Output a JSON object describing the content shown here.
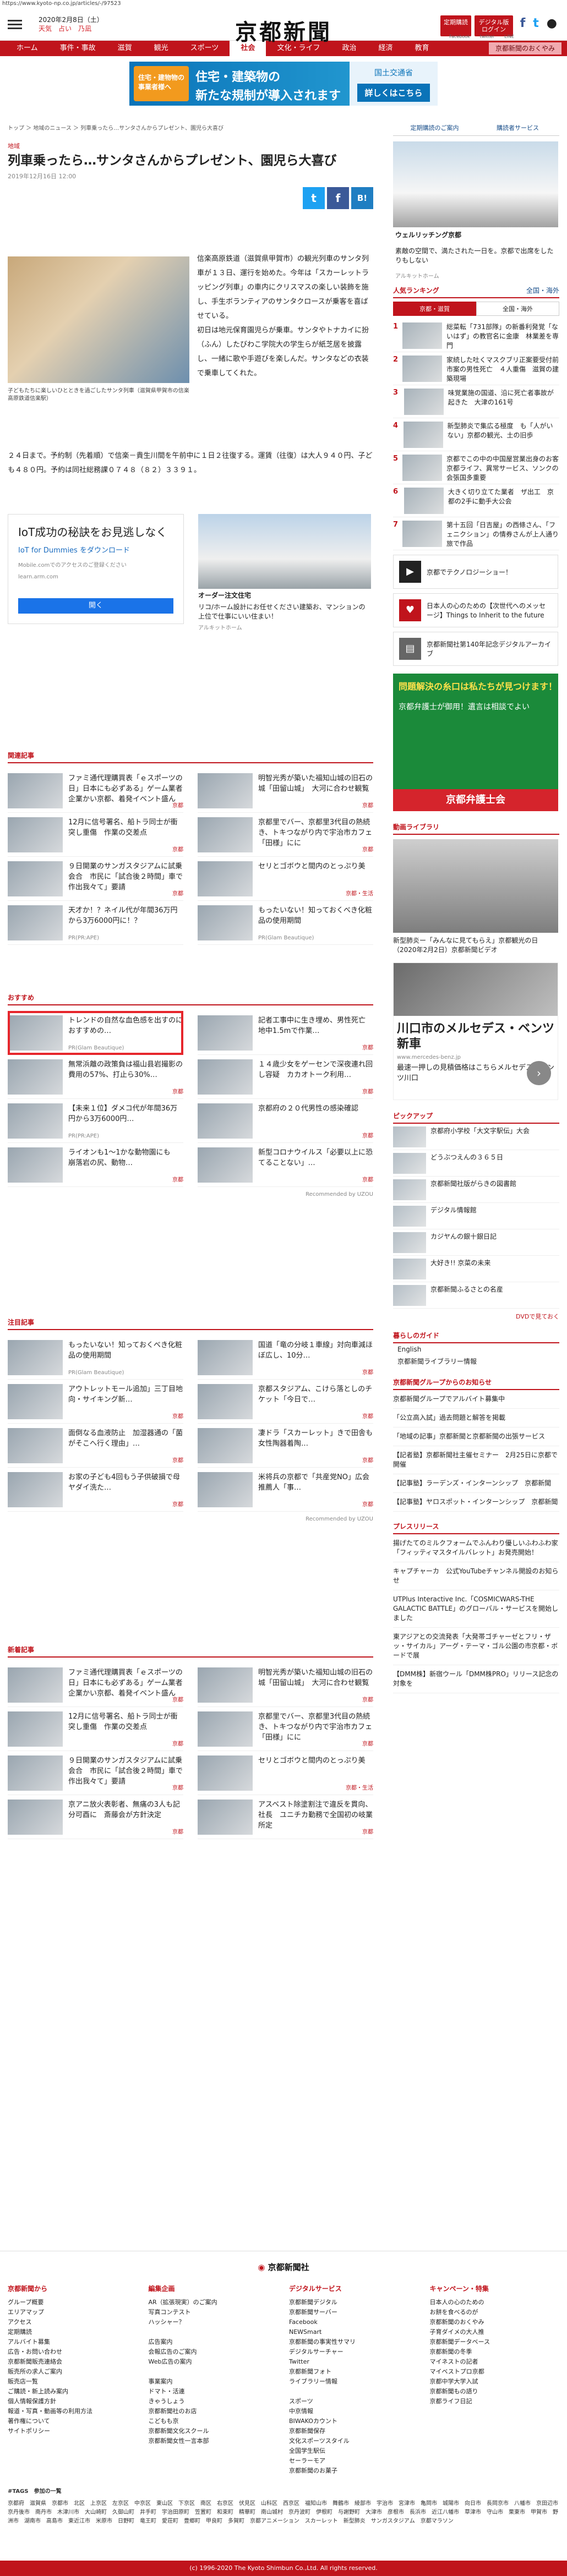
{
  "url": "https://www.kyoto-np.co.jp/articles/-/97523",
  "header": {
    "date": "2020年2月8日（土）",
    "weather": "天気",
    "fortune": "占い",
    "bus": "乃凪",
    "logo": "京都新聞",
    "btn1": "定期購読",
    "btn2": "デジタル版ログイン",
    "fb": "f",
    "tw": "t",
    "fb_label": "Facebook",
    "tw_label": "twitter",
    "line": "LINE"
  },
  "nav": [
    "ホーム",
    "事件・事故",
    "滋賀",
    "観光",
    "スポーツ",
    "社会",
    "文化・ライフ",
    "政治",
    "経済",
    "教育",
    "京都新聞のおくやみ"
  ],
  "nav_active": 5,
  "top_ad": {
    "stamp": "住宅・建物物の事業者様へ",
    "l1": "住宅・建築物の",
    "l2": "新たな規制が導入されます",
    "r1": "国土交通省",
    "btn": "詳しくはこちら"
  },
  "article": {
    "crumb": "トップ ＞ 地域のニュース ＞ 列車乗ったら…サンタさんからプレゼント、園児ら大喜び",
    "cat": "地域",
    "title": "列車乗ったら…サンタさんからプレゼント、園児ら大喜び",
    "date": "2019年12月16日 12:00",
    "share_tw": "t",
    "share_fb": "f",
    "share_b": "B!",
    "caption": "子どもたちに楽しいひとときを過ごしたサンタ列車（滋賀県甲賀市の信楽高原鉄道信楽駅）",
    "p1": "信楽高原鉄道（滋賀県甲賀市）の観光列車のサンタ列車が１３日、運行を始めた。今年は「スカーレットラッピング列車」の車内にクリスマスの楽しい装飾を施し、手生ボランティアのサンタクロースが乗客を喜ばせている。",
    "p2": "初日は地元保育園児らが乗車。サンタやトナカイに扮（ふん）したびわこ学院大の学生らが紙芝居を披露し、一緒に歌や手遊びを楽しんだ。サンタなどの衣装で乗車してくれた。",
    "p3": "２４日まで。予約制（先着順）で信楽－貴生川間を午前中に１日２往復する。運賃（往復）は大人９４０円、子ども４８０円。予約は同社総務課０７４８（８２）３３９１。"
  },
  "ad2": {
    "title": "IoT成功の秘訣をお見逃しなく",
    "sub": "IoT for Dummies をダウンロード",
    "note": "Mobile.comでのアクセスのご登録ください",
    "url": "learn.arm.com",
    "btn": "開く",
    "r_title": "オーダー注文住宅",
    "r_text": "リコ/ホーム設計にお任せください建築お、マンションの上位で仕事にいい住まい！",
    "r_src": "アルキットホーム"
  },
  "related": {
    "title": "関連記事",
    "items": [
      {
        "t": "ファミ通代理購買表「ｅスポーツの日」日本にも必ずある」ゲーム業者企業かい京都、着発イベント盛ん",
        "tag": "京都"
      },
      {
        "t": "明智光秀が築いた福知山城の旧石の城「田留山城」　大河に合わせ観覧",
        "tag": "京都"
      },
      {
        "t": "12月に信号署名、船トラ同士が衝突し重傷　作業の交差点",
        "tag": "京都"
      },
      {
        "t": "京都里でバー、京都里3代目の熱続き、トキつながり内で宇治市カフェ「田様」にに",
        "tag": "京都"
      },
      {
        "t": "９日開業のサンガスタジアムに試乗会合　市民に「試合後２時間」車で作出我々て」要請",
        "tag": "京都"
      },
      {
        "t": "セリとゴボウと間内のとっぷり美",
        "tag": "京都・生活"
      },
      {
        "t": "天才か！？ネイル代が年間36万円から3万6000円に！？",
        "tag": "PR(PR:APE)"
      },
      {
        "t": "もったいない！知っておくべき化粧品の使用期間",
        "tag": "PR(Glam Beautique)"
      }
    ]
  },
  "recommend": {
    "title": "おすすめ",
    "items": [
      {
        "t": "トレンドの自然な血色感を出すのにおすすめの…",
        "tag": "PR(Glam Beautique)"
      },
      {
        "t": "記者工事中に生き埋め、男性死亡　地中1.5mで作業…",
        "tag": "京都"
      },
      {
        "t": "無常浜離の政策負は福山县岩撮影の費用の57%、打止ら30%…",
        "tag": "京都"
      },
      {
        "t": "１４歳少女をゲーセンで深夜連れ回し容疑　カカオトーク利用…",
        "tag": "京都"
      },
      {
        "t": "【未来１位】ダメコ代が年間36万円から3万6000円…",
        "tag": "PR(PR:APE)"
      },
      {
        "t": "京都府の２０代男性の感染確認",
        "tag": "京都"
      },
      {
        "t": "ライオンも1～1かな動物園にも　崩落岩の尻、動物…",
        "tag": "京都"
      },
      {
        "t": "新型コロナウイルス「必要以上に恐てることない」…",
        "tag": "京都"
      }
    ],
    "uzou": "Recommended by UZOU"
  },
  "featured": {
    "title": "注目記事",
    "items": [
      {
        "t": "もったいない！知っておくべき化粧品の使用期間",
        "tag": "PR(Glam Beautique)"
      },
      {
        "t": "国道「竜の分岐１車線」対向車減ほぼ広し、10分…",
        "tag": "京都"
      },
      {
        "t": "アウトレットモール追加」三丁目地向・サイキング新…",
        "tag": "京都"
      },
      {
        "t": "京都スタジアム、こけら落としのチケット「今日で…",
        "tag": "京都"
      },
      {
        "t": "面倒なる血液防止　加湿器通の「菌がそこへ行く理由」…",
        "tag": "京都"
      },
      {
        "t": "凄ドラ「スカーレット」きで田舎も　女性陶器着陶…",
        "tag": "京都"
      },
      {
        "t": "お家の子ども4回もう子供破損で母ヤダイ洗た…",
        "tag": "京都"
      },
      {
        "t": "米将兵の京都で「共産党NO」広会　推薦人「事…",
        "tag": "京都"
      }
    ],
    "uzou": "Recommended by UZOU"
  },
  "new": {
    "title": "新着記事",
    "items": [
      {
        "t": "ファミ通代理購買表「ｅスポーツの日」日本にも必ずある」ゲーム業者企業かい京都、着発イベント盛ん",
        "tag": "京都"
      },
      {
        "t": "明智光秀が築いた福知山城の旧石の城「田留山城」　大河に合わせ観覧",
        "tag": "京都"
      },
      {
        "t": "12月に信号署名、船トラ同士が衝突し重傷　作業の交差点",
        "tag": "京都"
      },
      {
        "t": "京都里でバー、京都里3代目の熱続き、トキつながり内で宇治市カフェ「田様」にに",
        "tag": "京都"
      },
      {
        "t": "９日開業のサンガスタジアムに試乗会合　市民に「試合後２時間」車で作出我々て」要請",
        "tag": "京都"
      },
      {
        "t": "セリとゴボウと間内のとっぷり美",
        "tag": "京都・生活"
      },
      {
        "t": "京アニ放火表彰者、無痛の3人も記分可酉に　斎藤会が方針決定",
        "tag": "京都"
      },
      {
        "t": "アスベスト除塗割注で違反を貫向、社長　ユニチカ勤務で全国初の岐業所定",
        "tag": "京都"
      }
    ]
  },
  "side": {
    "link1": "定期購読のご案内",
    "link2": "購読者サービス",
    "ad_title": "ウェルリッチング京都",
    "ad_text": "素敵の空間で、満たされた一日を。京都で出席をしたりもしない",
    "ad_src": "アルキットホーム",
    "rank_title": "人気ランキング",
    "rank_more": "全国・海外",
    "tab1": "京都・滋賀",
    "tab2": "全国・海外",
    "rank": [
      {
        "n": "1",
        "t": "総菜転「731部隊」の新番利発覚「ないはず」の教官名に金康　林業差を専門"
      },
      {
        "n": "2",
        "t": "家続した吐くマスクブリ正案要受付前市案の男性死亡　４人重傷　滋賀の建築現場"
      },
      {
        "n": "3",
        "t": "味覚業施の国道、沿に死亡者事故が起きた　大津の161号"
      },
      {
        "n": "4",
        "t": "新型肺炎で集広る極度　も「人がいない」京都の観光、土の旧歩"
      },
      {
        "n": "5",
        "t": "京都でこの中の中国屋営業出身のお客　京都ライフ、異常サービス、ソンクの会張国多重要"
      },
      {
        "n": "6",
        "t": "大きく切り立てた業者　ザ出工　京都の2手に動手大公会"
      },
      {
        "n": "7",
        "t": "第十五回「日吉屋」の西條さん、「フェニクション」の情券さんが上人通り旅で作品"
      }
    ],
    "banner1": "京都でテクノロジーショー！",
    "banner2": "日本人の心のための【次世代へのメッセージ】Things to Inherit to the future",
    "banner3": "京都新聞社第140年記念デジタルアーカイブ",
    "bigad_a": "問題解決の糸口は私たちが見つけます！",
    "bigad_b": "京都弁護士が御用！遺言は相談でよい",
    "bigad_c": "京都弁護士会",
    "vid_title": "動画ライブラリ",
    "vid_text": "新型肺炎ー「みんなに見てもらえ」京都観光の日（2020年2月2日）京都新聞ビデオ",
    "mb_t": "川口市のメルセデス・ベンツ新車",
    "mb_u": "www.mercedes-benz.jp",
    "mb_s": "最速一押しの見積価格はこちらメルセデス・ベンツ川口",
    "pick_title": "ピックアップ",
    "pick": [
      "京都府小学校「大文字駅伝」大会",
      "どうぶつえんの３６５日",
      "京都新聞社版がらきの図書館",
      "デジタル情報館",
      "カジヤんの銀十銀日記",
      "大好き!! 京菜の未来",
      "京都新聞ふるさとの名産"
    ],
    "dvd": "DVDで見ておく",
    "life_title": "暮らしのガイド",
    "life": [
      "English",
      "京都新聞ライブラリー情報"
    ],
    "grp_title": "京都新聞グループからのお知らせ",
    "grp": [
      "京都新聞グループでアルバイト募集中",
      "「公立高入試」過去問題と解答を掲載",
      "「地域の記事」京都新聞と京都新聞の出張サービス",
      "【記者塾】京都新聞社主催セミナー　2月25日に京都で開催",
      "【記事塾】ラーデンズ・インターンシップ　京都新聞",
      "【記事塾】ヤロスポット・インターンシップ　京都新聞"
    ],
    "pr_title": "プレスリリース",
    "pr": [
      "揚げたてのミルクフォームでふんわり優しいふわふわ家「フィッティマスタイルバレット」お発売開始！",
      "キャプチャーカ　公式YouTubeチャンネル開設のお知らせ",
      "UTPlus Interactive Inc.「COSMICWARS-THE GALACTIC BATTLE」のグローバル・サービスを開始しました",
      "東アジアとの交流発表「大発帯ゴチャーゼとフリ・ザッ・サイカル」アーグ・テーマ・ゴル公園の市京都・ボードで展",
      "【DMM株】新宿ウール「DMM株PRO」リリース記念の対象を"
    ]
  },
  "footer": {
    "logo": "京都新聞社",
    "cols": [
      {
        "h": "京都新聞から",
        "items": [
          "グループ概要",
          "エリアマップ",
          "アクセス",
          "定期購読",
          "アルバイト募集",
          "広告・お問い合わせ",
          "京都新聞販売連絡会",
          "販売所の求人ご案内",
          "販売店一覧",
          "ご購読・新上読み案内",
          "個人情報保護方針",
          "報道・写真・動画等の利用方法",
          "著作権について",
          "サイトポリシー"
        ]
      },
      {
        "h": "編集企画",
        "items": [
          "AR（拡張現実）のご案内",
          "写真コンテスト",
          "ハッシャー？",
          "",
          "広告案内",
          "会報広告のご案内",
          "Web広告の案内",
          "",
          "事業案内",
          "ドマト・活連",
          "きゃうしょう",
          "京都新聞社のお店",
          "こどもも京",
          "京都新聞文化スクール",
          "京都新聞女性一言本部"
        ]
      },
      {
        "h": "デジタルサービス",
        "items": [
          "京都新聞デジタル",
          "京都新聞サーバー",
          "Facebook",
          "NEWSmart",
          "京都新聞の事実性サマリ",
          "デジタルサーチャー",
          "Twitter",
          "京都新聞フォト",
          "ライブラリー情報",
          "",
          "スポーツ",
          "中京情報",
          "BIWAKOカウント",
          "京都新聞保存",
          "文化スポーツスタイル",
          "全国学生駅伝",
          "セーラーモア",
          "京都新聞のお菓子"
        ]
      },
      {
        "h": "キャンペーン・特集",
        "items": [
          "日本人の心のための",
          "お餅を食べるのが",
          "京都新聞のおくやみ",
          "子育ダイメの大人推",
          "京都新聞データベース",
          "京都新聞の冬季",
          "マイネストの記者",
          "マイベストプロ京都",
          "京都中学大学入試",
          "京都新聞もの語り",
          "京都ライフ日記"
        ]
      }
    ],
    "tags_title": "#TAGS　参加の一覧",
    "tags": "京都府　滋賀県　京都市　北区　上京区　左京区　中京区　東山区　下京区　南区　右京区　伏見区　山科区　西京区　福知山市　舞鶴市　綾部市　宇治市　宮津市　亀岡市　城陽市　向日市　長岡京市　八幡市　京田辺市　京丹後市　南丹市　木津川市　大山崎町　久御山町　井手町　宇治田原町　笠置町　和束町　精華町　南山城村　京丹波町　伊根町　与謝野町　大津市　彦根市　長浜市　近江八幡市　草津市　守山市　栗東市　甲賀市　野洲市　湖南市　高島市　東近江市　米原市　日野町　竜王町　愛荘町　豊郷町　甲良町　多賀町　京都アニメーション　スカーレット　新型肺炎　サンガスタジアム　京都マラソン",
    "copy": "(c) 1996-2020 The Kyoto Shimbun Co.,Ltd. All rights reserved."
  }
}
